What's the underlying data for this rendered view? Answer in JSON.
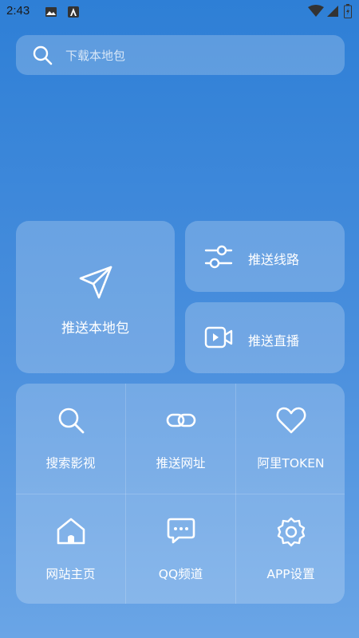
{
  "status_bar": {
    "time": "2:43"
  },
  "search": {
    "placeholder": "下载本地包"
  },
  "actions": {
    "push_local": "推送本地包",
    "push_route": "推送线路",
    "push_live": "推送直播"
  },
  "grid": {
    "items": [
      {
        "label": "搜索影视",
        "icon": "search-icon"
      },
      {
        "label": "推送网址",
        "icon": "link-icon"
      },
      {
        "label": "阿里TOKEN",
        "icon": "heart-icon"
      },
      {
        "label": "网站主页",
        "icon": "home-icon"
      },
      {
        "label": "QQ频道",
        "icon": "chat-icon"
      },
      {
        "label": "APP设置",
        "icon": "gear-icon"
      }
    ]
  }
}
